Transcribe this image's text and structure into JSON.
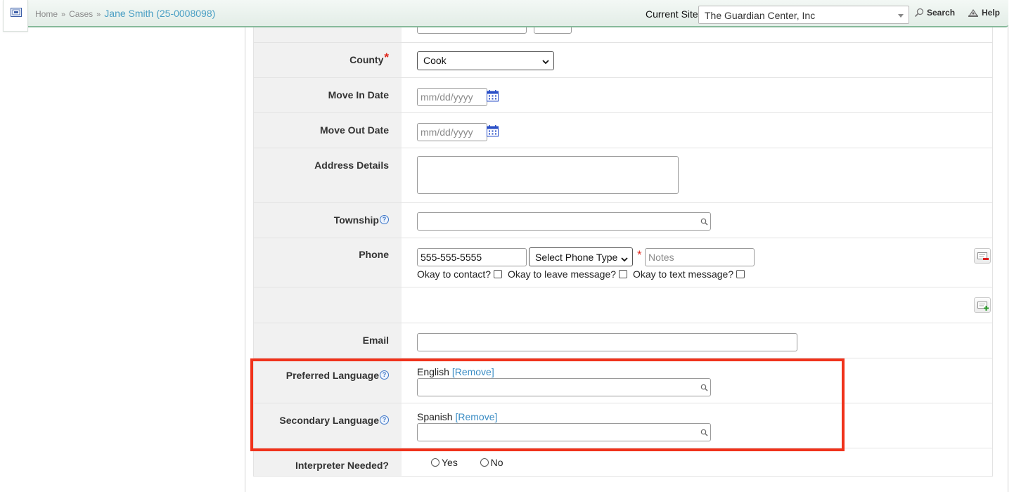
{
  "topbar": {
    "home_icon": "home-icon",
    "breadcrumb": {
      "home": "Home",
      "sep1": "»",
      "cases": "Cases",
      "sep2": "»",
      "current": "Jane Smith (25-0008098)"
    },
    "current_site_label": "Current Site",
    "current_site_value": "The Guardian Center, Inc",
    "search_label": "Search",
    "help_label": "Help"
  },
  "form": {
    "county": {
      "label": "County",
      "required_mark": "*",
      "value": "Cook"
    },
    "move_in_date": {
      "label": "Move In Date",
      "placeholder": "mm/dd/yyyy"
    },
    "move_out_date": {
      "label": "Move Out Date",
      "placeholder": "mm/dd/yyyy"
    },
    "address_details": {
      "label": "Address Details",
      "value": ""
    },
    "township": {
      "label": "Township",
      "help": "?",
      "value": ""
    },
    "phone": {
      "label": "Phone",
      "number": "555-555-5555",
      "type_select": "Select Phone Type",
      "required_mark": "*",
      "notes_placeholder": "Notes",
      "ok_contact": "Okay to contact?",
      "ok_message": "Okay to leave message?",
      "ok_text": "Okay to text message?"
    },
    "email": {
      "label": "Email",
      "value": ""
    },
    "preferred_language": {
      "label": "Preferred Language",
      "help": "?",
      "selected": "English",
      "remove": "[Remove]"
    },
    "secondary_language": {
      "label": "Secondary Language",
      "help": "?",
      "selected": "Spanish",
      "remove": "[Remove]"
    },
    "interpreter": {
      "label": "Interpreter Needed?",
      "yes": "Yes",
      "no": "No"
    }
  },
  "colors": {
    "accent": "#4a9fc4",
    "required": "#e0261b",
    "highlight": "#f0321b",
    "topbar_border": "#86b99a"
  }
}
